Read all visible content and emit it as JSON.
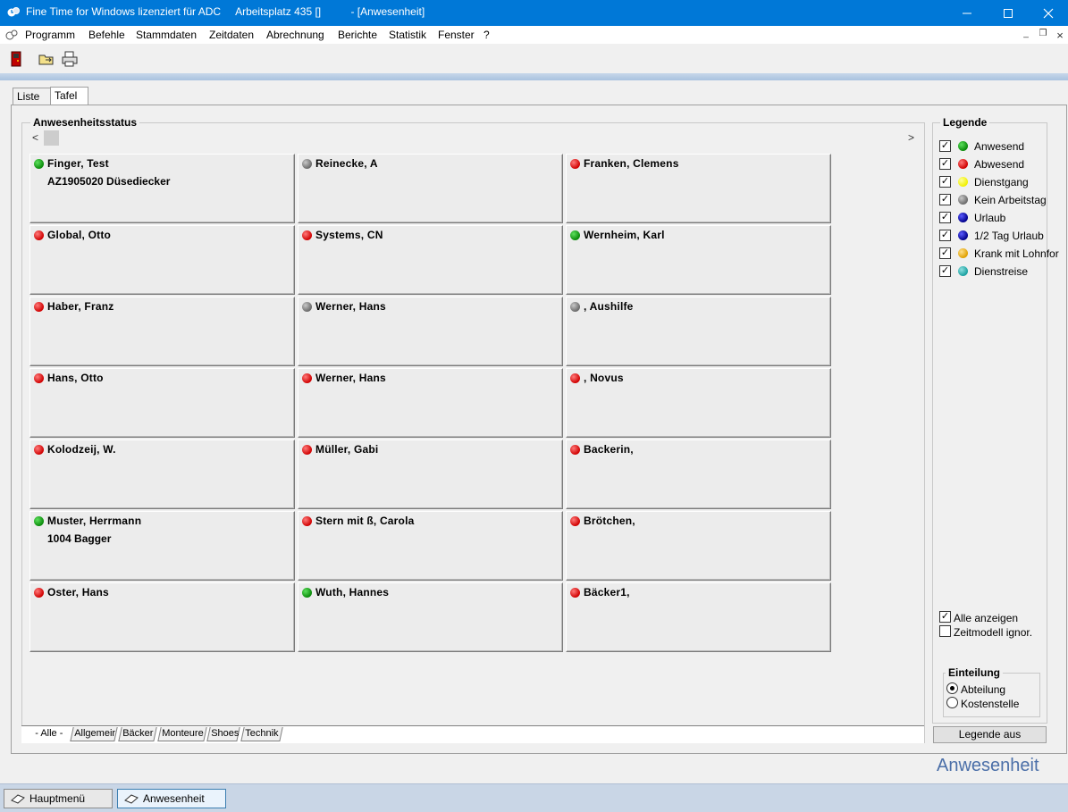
{
  "window": {
    "title": "Fine Time for Windows lizenziert für ADC     Arbeitsplatz 435 []          - [Anwesenheit]",
    "minimize_glyph": "—",
    "maximize_glyph": "☐",
    "close_glyph": "✕"
  },
  "menu": {
    "items": [
      "Programm",
      "Befehle",
      "Stammdaten",
      "Zeitdaten",
      "Abrechnung",
      "Berichte",
      "Statistik",
      "Fenster",
      "?"
    ],
    "mdi_min": "_",
    "mdi_restore": "❐",
    "mdi_close": "×"
  },
  "toolbar": {
    "icons": [
      "exit-door-icon",
      "folder-arrow-icon",
      "printer-icon"
    ]
  },
  "tabs": [
    "Liste",
    "Tafel"
  ],
  "status_group": {
    "title": "Anwesenheitsstatus",
    "scroll_left": "<",
    "scroll_right": ">"
  },
  "cards": [
    {
      "name": "Finger, Test",
      "sub": "AZ1905020 Düsediecker",
      "color": "green"
    },
    {
      "name": "Reinecke, A",
      "sub": "",
      "color": "gray"
    },
    {
      "name": "Franken, Clemens",
      "sub": "",
      "color": "red"
    },
    {
      "name": "Global, Otto",
      "sub": "",
      "color": "red"
    },
    {
      "name": "Systems, CN",
      "sub": "",
      "color": "red"
    },
    {
      "name": "Wernheim, Karl",
      "sub": "",
      "color": "green"
    },
    {
      "name": "Haber, Franz",
      "sub": "",
      "color": "red"
    },
    {
      "name": "Werner, Hans",
      "sub": "",
      "color": "gray"
    },
    {
      "name": ", Aushilfe",
      "sub": "",
      "color": "gray"
    },
    {
      "name": "Hans, Otto",
      "sub": "",
      "color": "red"
    },
    {
      "name": "Werner, Hans",
      "sub": "",
      "color": "red"
    },
    {
      "name": ", Novus",
      "sub": "",
      "color": "red"
    },
    {
      "name": "Kolodzeij, W.",
      "sub": "",
      "color": "red"
    },
    {
      "name": "Müller, Gabi",
      "sub": "",
      "color": "red"
    },
    {
      "name": "Backerin,",
      "sub": "",
      "color": "red"
    },
    {
      "name": "Muster, Herrmann",
      "sub": "1004 Bagger",
      "color": "green"
    },
    {
      "name": "Stern mit ß, Carola",
      "sub": "",
      "color": "red"
    },
    {
      "name": "Brötchen,",
      "sub": "",
      "color": "red"
    },
    {
      "name": "Oster, Hans",
      "sub": "",
      "color": "red"
    },
    {
      "name": "Wuth, Hannes",
      "sub": "",
      "color": "green"
    },
    {
      "name": "Bäcker1,",
      "sub": "",
      "color": "red"
    }
  ],
  "bottom_tabs": [
    "- Alle -",
    "Allgemeir",
    "Bäcker",
    "Monteure",
    "Shoes",
    "Technik"
  ],
  "legend": {
    "title": "Legende",
    "items": [
      {
        "label": "Anwesend",
        "color": "green",
        "checked": true
      },
      {
        "label": "Abwesend",
        "color": "red",
        "checked": true
      },
      {
        "label": "Dienstgang",
        "color": "yellow",
        "checked": true
      },
      {
        "label": "Kein Arbeitstag",
        "color": "gray",
        "checked": true
      },
      {
        "label": "Urlaub",
        "color": "navy",
        "checked": true
      },
      {
        "label": "1/2 Tag Urlaub",
        "color": "navy",
        "checked": true
      },
      {
        "label": "Krank mit Lohnfor",
        "color": "orange",
        "checked": true
      },
      {
        "label": "Dienstreise",
        "color": "teal",
        "checked": true
      }
    ],
    "show_all": {
      "label": "Alle anzeigen",
      "checked": true
    },
    "ignore_model": {
      "label": "Zeitmodell ignor.",
      "checked": false
    },
    "division": {
      "title": "Einteilung",
      "options": [
        {
          "label": "Abteilung",
          "selected": true
        },
        {
          "label": "Kostenstelle",
          "selected": false
        }
      ]
    },
    "toggle_button": "Legende aus",
    "check_mark": "✓"
  },
  "brand_label": "Anwesenheit",
  "taskbar": [
    "Hauptmenü",
    "Anwesenheit"
  ]
}
